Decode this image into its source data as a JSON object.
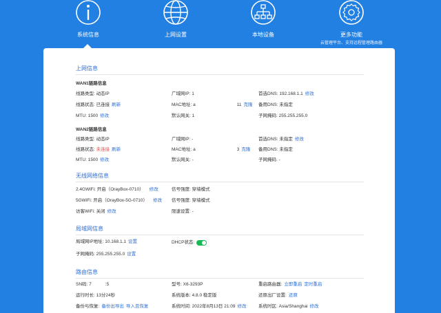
{
  "nav": {
    "items": [
      {
        "label": "系统信息",
        "icon": "info-icon"
      },
      {
        "label": "上网设置",
        "icon": "globe-icon"
      },
      {
        "label": "本地设备",
        "icon": "network-icon"
      },
      {
        "label": "更多功能",
        "icon": "gear-icon",
        "sub": "云管理平台、支持远程管理路由器"
      }
    ],
    "active": "系统信息"
  },
  "colors": {
    "brand": "#2380e3",
    "link": "#2e6fd6",
    "alert": "#e34d4d",
    "toggle_on": "#19b955"
  },
  "internet": {
    "title": "上网信息",
    "wan1": {
      "title": "WAN1链路信息",
      "link_type_label": "线路类型:",
      "link_type": "动态IP",
      "link_status_label": "线路状态:",
      "link_status": "已连接",
      "refresh": "刷新",
      "mtu_label": "MTU:",
      "mtu": "1500",
      "mtu_edit": "修改",
      "wan_ip_label": "广域网IP:",
      "wan_ip": "1",
      "mac_label": "MAC地址:",
      "mac_a": "a",
      "mac_b": "11",
      "mac_clone": "克隆",
      "gateway_label": "默认网关:",
      "gateway": "1",
      "dns1_label": "首选DNS:",
      "dns1": "192.168.1.1",
      "dns1_edit": "修改",
      "dns2_label": "备用DNS:",
      "dns2": "未指定",
      "mask_label": "子网掩码:",
      "mask": "255.255.255.0"
    },
    "wan2": {
      "title": "WAN2链路信息",
      "link_type_label": "线路类型:",
      "link_type": "动态IP",
      "link_status_label": "线路状态:",
      "link_status": "未连接",
      "refresh": "刷新",
      "mtu_label": "MTU:",
      "mtu": "1500",
      "mtu_edit": "修改",
      "wan_ip_label": "广域网IP:",
      "wan_ip": "-",
      "mac_label": "MAC地址:",
      "mac_a": "a",
      "mac_b": "3",
      "mac_clone": "克隆",
      "gateway_label": "默认网关:",
      "gateway": "-",
      "dns1_label": "首选DNS:",
      "dns1": "未指定",
      "dns1_edit": "修改",
      "dns2_label": "备用DNS:",
      "dns2": "未指定",
      "mask_label": "子网掩码:",
      "mask": "-"
    }
  },
  "wireless": {
    "title": "无线网络信息",
    "wifi24": "2.4GWiFi:  开启（OrayBox-0710）",
    "wifi24_edit": "修改",
    "wifi5": "5GWiFi:  开启（OrayBox-5G-0710）",
    "wifi5_edit": "修改",
    "guest": "访客WiFi:  关闭",
    "guest_edit": "修改",
    "signal1": "信号强度:  穿墙模式",
    "signal2": "信号强度:  穿墙模式",
    "rate_limit": "限速设置:  -"
  },
  "lan": {
    "title": "局域网信息",
    "ip_label": "局域网IP地址:",
    "ip": "10.168.1.1",
    "ip_set": "设置",
    "mask_label": "子网掩码:",
    "mask": "255.255.255.0",
    "mask_set": "设置",
    "dhcp_label": "DHCP状态:"
  },
  "router": {
    "title": "路由信息",
    "sn_label": "SN码:",
    "sn_a": "7",
    "sn_b": ":5",
    "uptime_label": "运行时长:",
    "uptime": "13分24秒",
    "backup_label": "备份与恢复:",
    "backup_export": "备份出导出",
    "backup_import": "导入且恢复",
    "model_label": "型号:",
    "model": "X6-3293P",
    "version_label": "系统版本:",
    "version": "4.8.0 稳定版",
    "time_label": "系统时间:",
    "time": "2022年8月13日 21:09",
    "time_edit": "修改",
    "reboot_label": "重启路由器:",
    "reboot_now": "立即重启",
    "reboot_timer": "定时重启",
    "factory_label": "还原出厂设置:",
    "factory": "还原",
    "tz_label": "系统时区:",
    "tz": "Asia/Shanghai",
    "tz_edit": "修改"
  }
}
